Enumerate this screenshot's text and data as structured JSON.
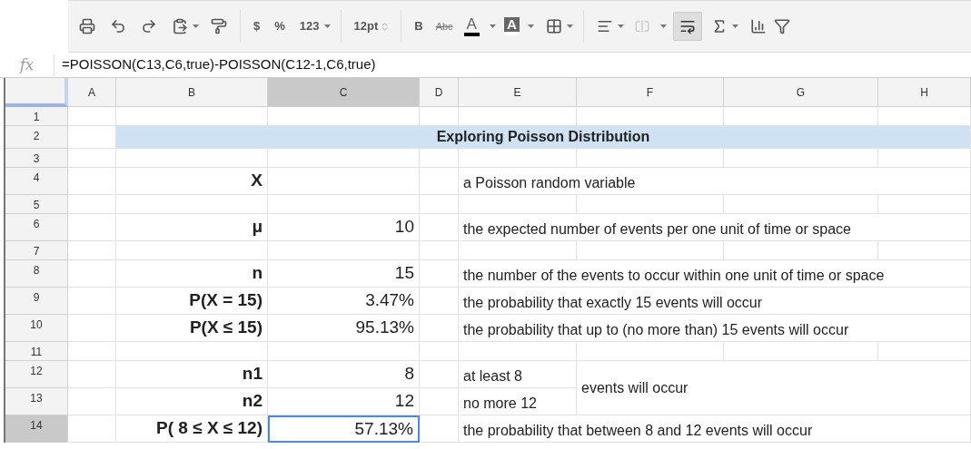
{
  "toolbar": {
    "currency": "$",
    "percent": "%",
    "number_format": "123",
    "font_size": "12pt",
    "bold": "B",
    "strikethrough": "Abc",
    "text_color": "A",
    "fill_color": "A",
    "wrap_selected": true
  },
  "formula_bar": {
    "label": "fx",
    "formula": "=POISSON(C13,C6,true)-POISSON(C12-1,C6,true)"
  },
  "table": {
    "columns": [
      {
        "label": "A",
        "selected": false
      },
      {
        "label": "B",
        "selected": false
      },
      {
        "label": "C",
        "selected": true
      },
      {
        "label": "D",
        "selected": false
      },
      {
        "label": "E",
        "selected": false
      },
      {
        "label": "F",
        "selected": false
      },
      {
        "label": "G",
        "selected": false
      },
      {
        "label": "H",
        "selected": false
      }
    ],
    "rows": [
      {
        "number": "1",
        "selected": false
      },
      {
        "number": "2",
        "selected": false,
        "title": "Exploring Poisson Distribution"
      },
      {
        "number": "3",
        "selected": false
      },
      {
        "number": "4",
        "selected": false,
        "label": "X",
        "description": {
          "text": "a Poisson random variable",
          "kind": "wide"
        }
      },
      {
        "number": "5",
        "selected": false
      },
      {
        "number": "6",
        "selected": false,
        "label": "μ",
        "value": {
          "text": "10",
          "selected": false
        },
        "description": {
          "text": "the expected number of events per one unit of time or space",
          "kind": "wide"
        }
      },
      {
        "number": "7",
        "selected": false
      },
      {
        "number": "8",
        "selected": false,
        "label": "n",
        "value": {
          "text": "15",
          "selected": false
        },
        "description": {
          "text": "the number of the events to occur within one unit of time or space",
          "kind": "wide"
        }
      },
      {
        "number": "9",
        "selected": false,
        "label": "P(X = 15)",
        "value": {
          "text": "3.47%",
          "selected": false
        },
        "description": {
          "text": "the probability that exactly 15 events will occur",
          "kind": "wide"
        }
      },
      {
        "number": "10",
        "selected": false,
        "label": "P(X ≤ 15)",
        "value": {
          "text": "95.13%",
          "selected": false
        },
        "description": {
          "text": "the probability that up to (no more than) 15 events will occur",
          "kind": "wide"
        }
      },
      {
        "number": "11",
        "selected": false
      },
      {
        "number": "12",
        "selected": false,
        "label": "n1",
        "value": {
          "text": "8",
          "selected": false
        },
        "description": {
          "text": "at least 8",
          "kind": "narrow"
        },
        "note": "events will occur"
      },
      {
        "number": "13",
        "selected": false,
        "label": "n2",
        "value": {
          "text": "12",
          "selected": false
        },
        "description": {
          "text": "no more 12",
          "kind": "narrow"
        }
      },
      {
        "number": "14",
        "selected": true,
        "label": "P( 8 ≤ X ≤ 12)",
        "value": {
          "text": "57.13%",
          "selected": true
        },
        "description": {
          "text": "the probability that between 8 and 12 events will occur",
          "kind": "wide"
        }
      }
    ]
  }
}
